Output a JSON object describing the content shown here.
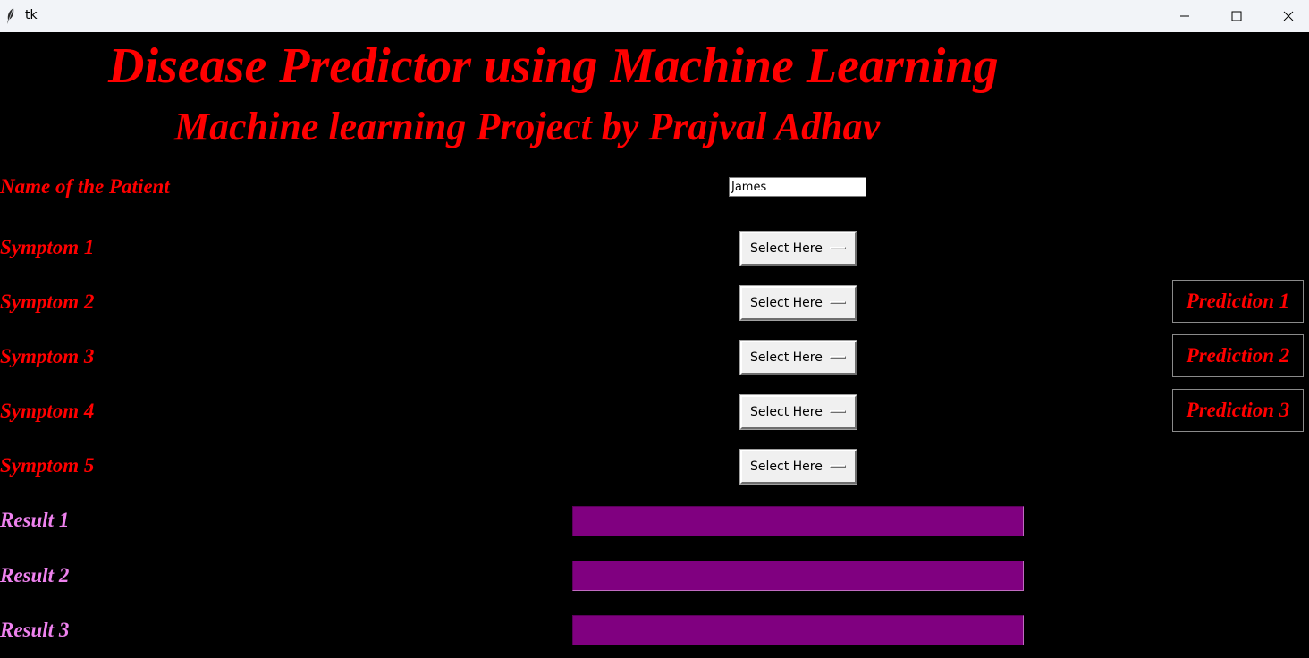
{
  "window": {
    "title": "tk",
    "icons": {
      "app": "feather-icon",
      "minimize": "minimize-icon",
      "maximize": "maximize-icon",
      "close": "close-icon"
    }
  },
  "header": {
    "title": "Disease Predictor using Machine Learning",
    "subtitle": "Machine learning Project by Prajval Adhav"
  },
  "form": {
    "name_label": "Name of the Patient",
    "name_value": "James",
    "symptoms": [
      {
        "label": "Symptom 1",
        "value": "Select Here"
      },
      {
        "label": "Symptom 2",
        "value": "Select Here"
      },
      {
        "label": "Symptom 3",
        "value": "Select Here"
      },
      {
        "label": "Symptom 4",
        "value": "Select Here"
      },
      {
        "label": "Symptom 5",
        "value": "Select Here"
      }
    ],
    "results": [
      {
        "label": "Result 1",
        "value": ""
      },
      {
        "label": "Result 2",
        "value": ""
      },
      {
        "label": "Result 3",
        "value": ""
      }
    ]
  },
  "buttons": {
    "prediction_1": "Prediction 1",
    "prediction_2": "Prediction 2",
    "prediction_3": "Prediction 3"
  },
  "colors": {
    "background": "#000000",
    "heading": "#ff0000",
    "result_label": "#ee82ee",
    "result_field": "#800080"
  }
}
